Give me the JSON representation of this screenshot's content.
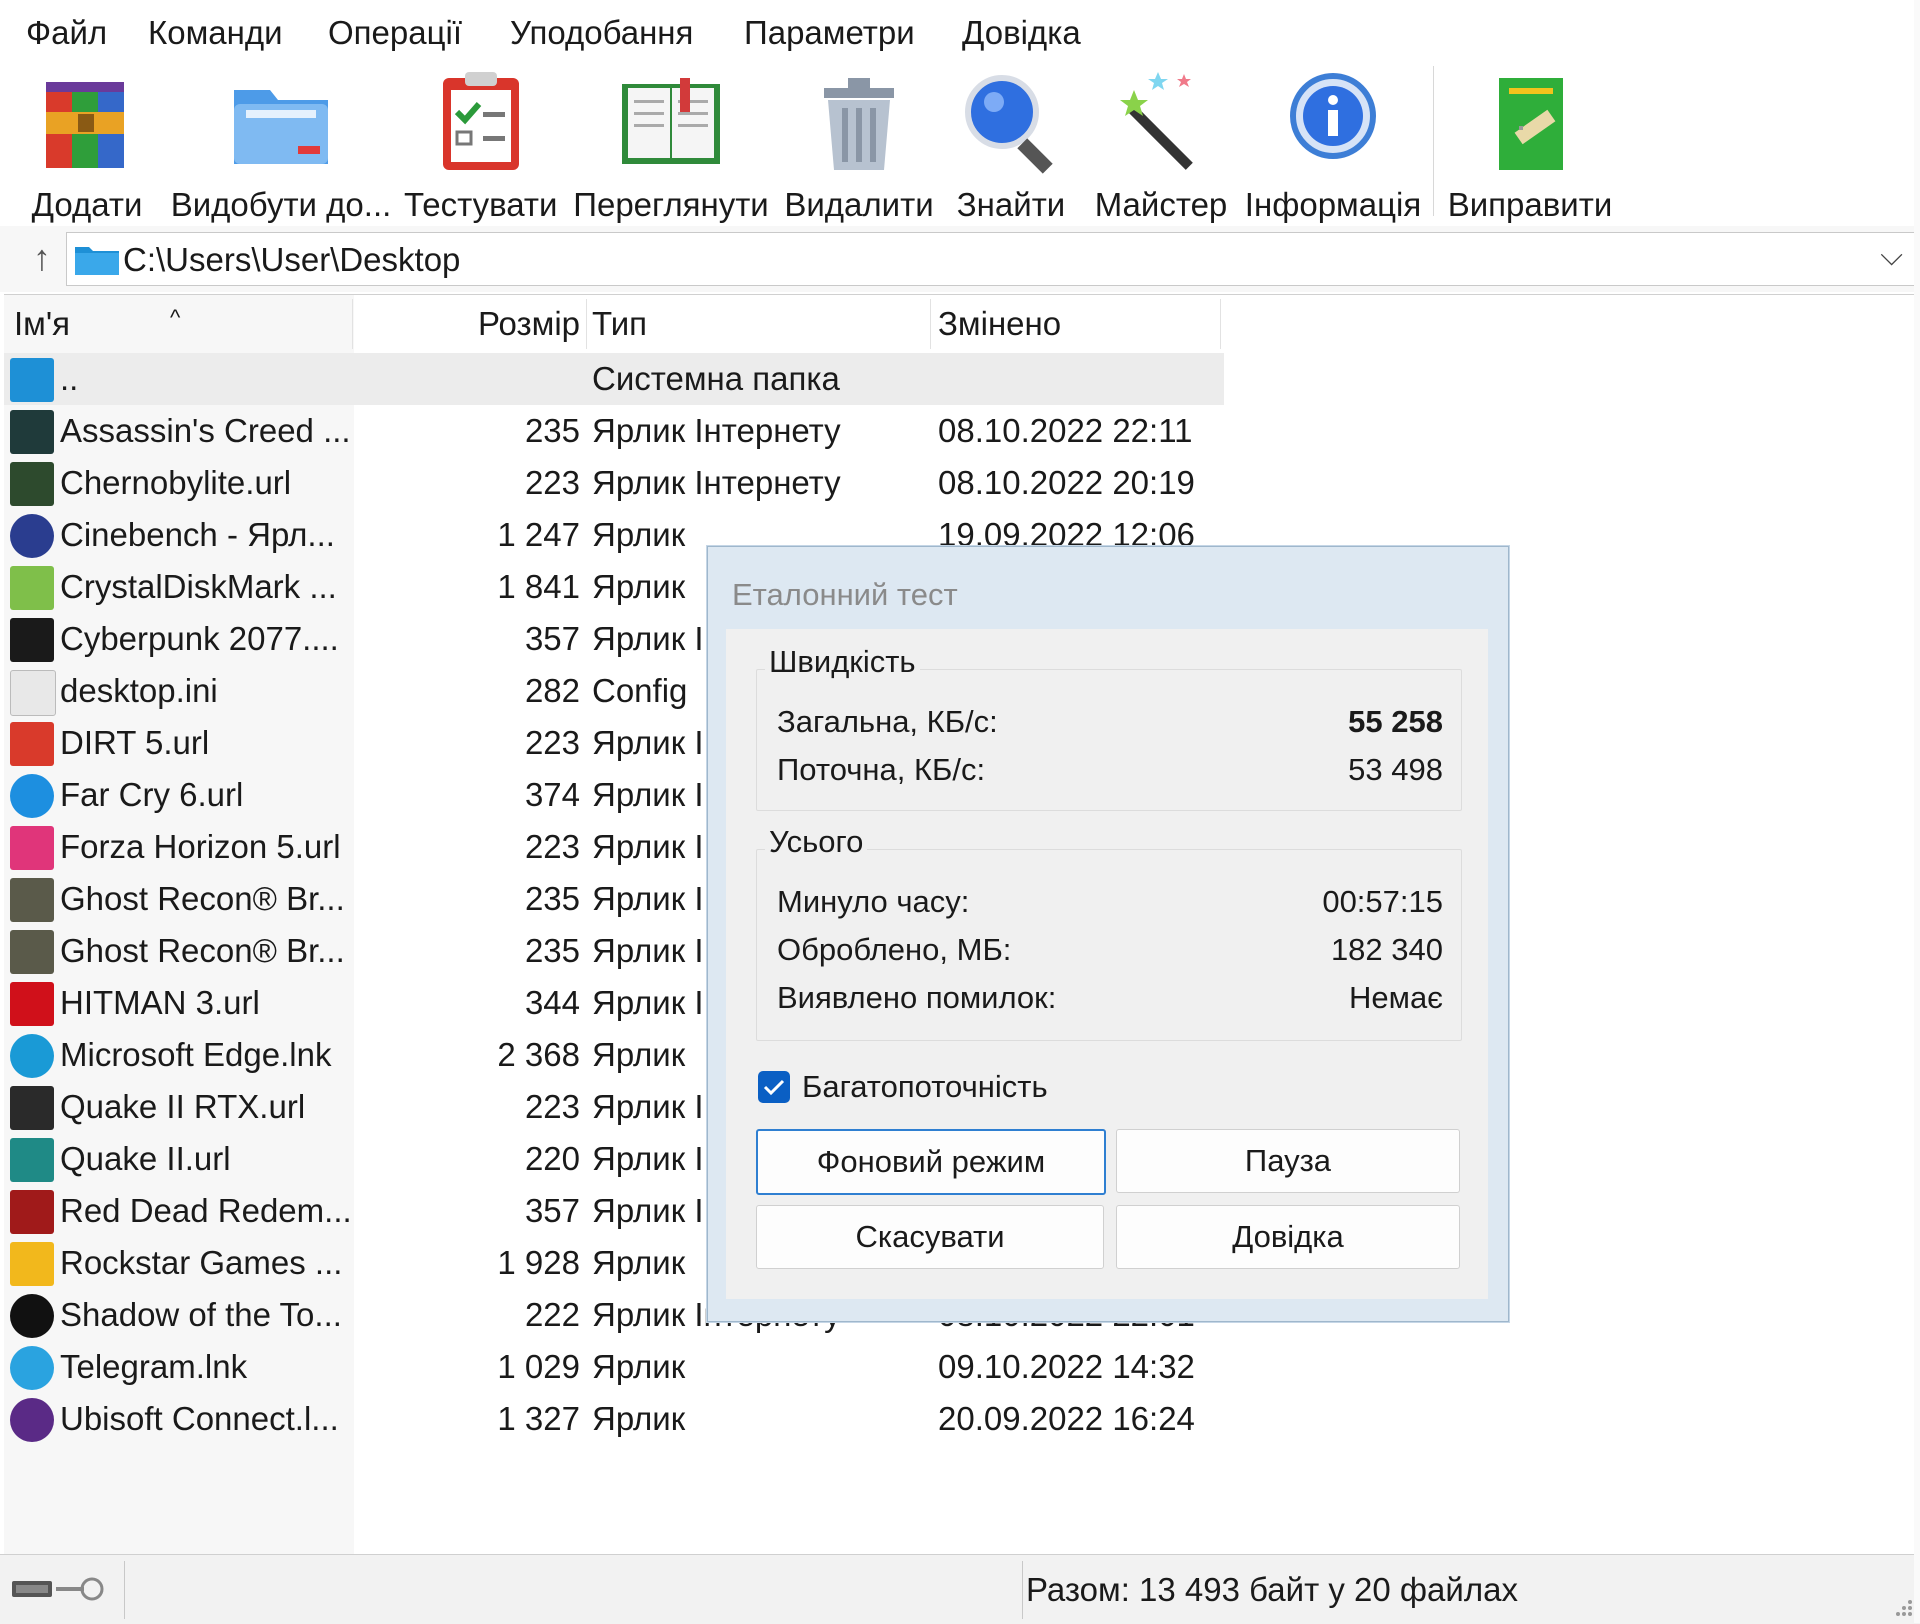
{
  "menu": [
    "Файл",
    "Команди",
    "Операції",
    "Уподобання",
    "Параметри",
    "Довідка"
  ],
  "toolbar": [
    {
      "label": "Додати",
      "icon": "add-archive-icon"
    },
    {
      "label": "Видобути до...",
      "icon": "extract-folder-icon"
    },
    {
      "label": "Тестувати",
      "icon": "test-checklist-icon"
    },
    {
      "label": "Переглянути",
      "icon": "view-book-icon"
    },
    {
      "label": "Видалити",
      "icon": "delete-trash-icon"
    },
    {
      "label": "Знайти",
      "icon": "find-magnifier-icon"
    },
    {
      "label": "Майстер",
      "icon": "wizard-wand-icon"
    },
    {
      "label": "Інформація",
      "icon": "info-icon"
    },
    {
      "label": "Виправити",
      "icon": "repair-icon"
    }
  ],
  "address": {
    "path": "C:\\Users\\User\\Desktop"
  },
  "columns": {
    "name": "Ім'я",
    "size": "Розмір",
    "type": "Тип",
    "modified": "Змінено"
  },
  "files": [
    {
      "name": "..",
      "size": "",
      "type": "Системна папка",
      "modified": "",
      "icon": "folder-icon",
      "color": "#1e90d6"
    },
    {
      "name": "Assassin's Creed ...",
      "size": "235",
      "type": "Ярлик Інтернету",
      "modified": "08.10.2022 22:11",
      "icon": "assassins-creed-icon",
      "color": "#1f3a3a"
    },
    {
      "name": "Chernobylite.url",
      "size": "223",
      "type": "Ярлик Інтернету",
      "modified": "08.10.2022 20:19",
      "icon": "chernobylite-icon",
      "color": "#2d4a2d"
    },
    {
      "name": "Cinebench - Ярл...",
      "size": "1 247",
      "type": "Ярлик",
      "modified": "19.09.2022 12:06",
      "icon": "cinebench-icon",
      "color": "#2a3d8f"
    },
    {
      "name": "CrystalDiskMark ...",
      "size": "1 841",
      "type": "Ярлик",
      "modified": "",
      "icon": "crystaldiskmark-icon",
      "color": "#7fbf4a"
    },
    {
      "name": "Cyberpunk 2077....",
      "size": "357",
      "type": "Ярлик І",
      "modified": "",
      "icon": "cyberpunk-icon",
      "color": "#1a1a1a"
    },
    {
      "name": "desktop.ini",
      "size": "282",
      "type": "Config",
      "modified": "",
      "icon": "ini-file-icon",
      "color": "#e8e8e8"
    },
    {
      "name": "DIRT 5.url",
      "size": "223",
      "type": "Ярлик І",
      "modified": "",
      "icon": "dirt5-icon",
      "color": "#d93a2b"
    },
    {
      "name": "Far Cry 6.url",
      "size": "374",
      "type": "Ярлик І",
      "modified": "",
      "icon": "ubisoft-swirl-icon",
      "color": "#1d8fe0"
    },
    {
      "name": "Forza Horizon 5.url",
      "size": "223",
      "type": "Ярлик І",
      "modified": "",
      "icon": "forza-icon",
      "color": "#e0357a"
    },
    {
      "name": "Ghost Recon® Br...",
      "size": "235",
      "type": "Ярлик І",
      "modified": "",
      "icon": "ghost-recon-icon",
      "color": "#5a5a4a"
    },
    {
      "name": "Ghost Recon® Br...",
      "size": "235",
      "type": "Ярлик І",
      "modified": "",
      "icon": "ghost-recon-icon",
      "color": "#5a5a4a"
    },
    {
      "name": "HITMAN 3.url",
      "size": "344",
      "type": "Ярлик І",
      "modified": "",
      "icon": "hitman-icon",
      "color": "#d0101a"
    },
    {
      "name": "Microsoft Edge.lnk",
      "size": "2 368",
      "type": "Ярлик",
      "modified": "",
      "icon": "edge-icon",
      "color": "#1a9ad6"
    },
    {
      "name": "Quake II RTX.url",
      "size": "223",
      "type": "Ярлик І",
      "modified": "",
      "icon": "quake-rtx-icon",
      "color": "#2a2a2a"
    },
    {
      "name": "Quake II.url",
      "size": "220",
      "type": "Ярлик І",
      "modified": "",
      "icon": "quake-icon",
      "color": "#1f8a86"
    },
    {
      "name": "Red Dead Redem...",
      "size": "357",
      "type": "Ярлик І",
      "modified": "",
      "icon": "red-dead-icon",
      "color": "#a01a1a"
    },
    {
      "name": "Rockstar Games ...",
      "size": "1 928",
      "type": "Ярлик",
      "modified": "",
      "icon": "rockstar-icon",
      "color": "#f2b81c"
    },
    {
      "name": "Shadow of the To...",
      "size": "222",
      "type": "Ярлик Інтернету",
      "modified": "08.10.2022 22.01",
      "icon": "shadow-tomb-raider-icon",
      "color": "#111111"
    },
    {
      "name": "Telegram.lnk",
      "size": "1 029",
      "type": "Ярлик",
      "modified": "09.10.2022 14:32",
      "icon": "telegram-icon",
      "color": "#2aa3e0"
    },
    {
      "name": "Ubisoft Connect.l...",
      "size": "1 327",
      "type": "Ярлик",
      "modified": "20.09.2022 16:24",
      "icon": "ubisoft-icon",
      "color": "#5a2a86"
    }
  ],
  "status": {
    "summary": "Разом: 13 493 байт у 20 файлах"
  },
  "dialog": {
    "title": "Еталонний тест",
    "speed_group": "Швидкість",
    "total_label": "Загальна, КБ/с:",
    "total_value": "55 258",
    "current_label": "Поточна, КБ/с:",
    "current_value": "53 498",
    "overall_group": "Усього",
    "elapsed_label": "Минуло часу:",
    "elapsed_value": "00:57:15",
    "processed_label": "Оброблено, МБ:",
    "processed_value": "182 340",
    "errors_label": "Виявлено помилок:",
    "errors_value": "Немає",
    "multithread_label": "Багатопоточність",
    "multithread_checked": true,
    "btn_background": "Фоновий режим",
    "btn_pause": "Пауза",
    "btn_cancel": "Скасувати",
    "btn_help": "Довідка"
  }
}
